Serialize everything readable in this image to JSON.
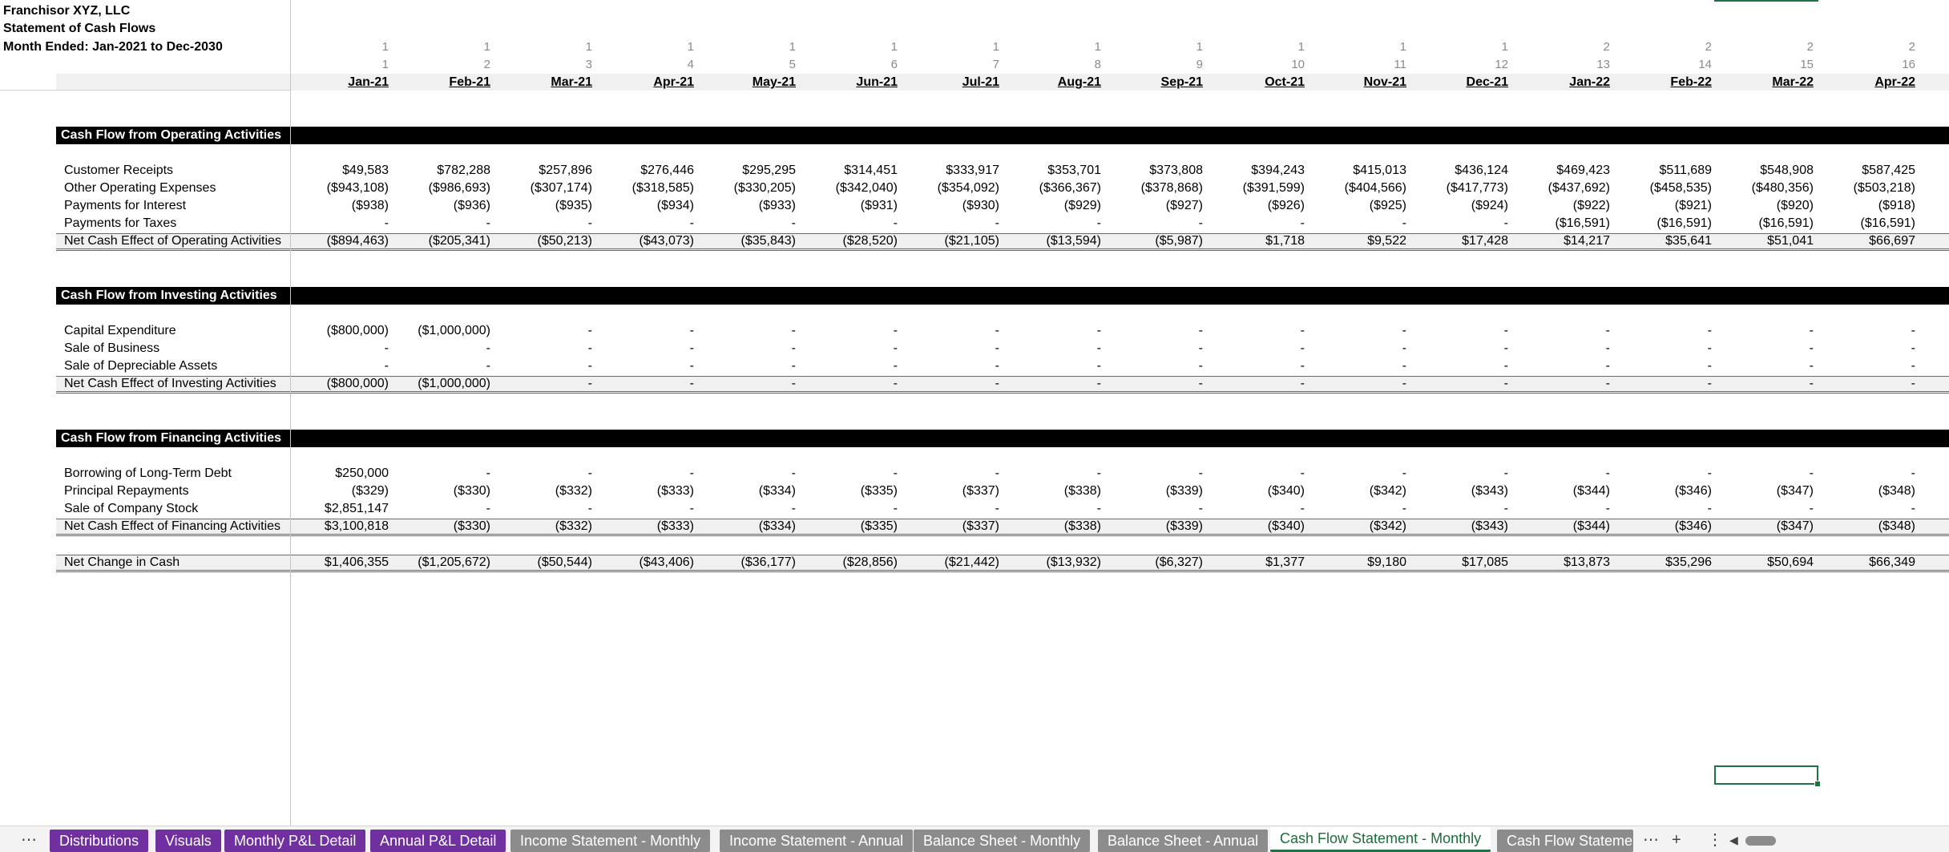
{
  "header": {
    "company": "Franchisor XYZ, LLC",
    "statement": "Statement of Cash Flows",
    "period": "Month Ended: Jan-2021 to Dec-2030"
  },
  "columns": {
    "year_index": [
      "1",
      "1",
      "1",
      "1",
      "1",
      "1",
      "1",
      "1",
      "1",
      "1",
      "1",
      "1",
      "2",
      "2",
      "2",
      "2"
    ],
    "month_index": [
      "1",
      "2",
      "3",
      "4",
      "5",
      "6",
      "7",
      "8",
      "9",
      "10",
      "11",
      "12",
      "13",
      "14",
      "15",
      "16"
    ],
    "months": [
      "Jan-21",
      "Feb-21",
      "Mar-21",
      "Apr-21",
      "May-21",
      "Jun-21",
      "Jul-21",
      "Aug-21",
      "Sep-21",
      "Oct-21",
      "Nov-21",
      "Dec-21",
      "Jan-22",
      "Feb-22",
      "Mar-22",
      "Apr-22"
    ]
  },
  "sections": [
    {
      "title": "Cash Flow from Operating Activities",
      "rows": [
        {
          "label": "Customer Receipts",
          "values": [
            "$49,583",
            "$782,288",
            "$257,896",
            "$276,446",
            "$295,295",
            "$314,451",
            "$333,917",
            "$353,701",
            "$373,808",
            "$394,243",
            "$415,013",
            "$436,124",
            "$469,423",
            "$511,689",
            "$548,908",
            "$587,425"
          ]
        },
        {
          "label": "Other Operating Expenses",
          "values": [
            "($943,108)",
            "($986,693)",
            "($307,174)",
            "($318,585)",
            "($330,205)",
            "($342,040)",
            "($354,092)",
            "($366,367)",
            "($378,868)",
            "($391,599)",
            "($404,566)",
            "($417,773)",
            "($437,692)",
            "($458,535)",
            "($480,356)",
            "($503,218)"
          ]
        },
        {
          "label": "Payments for Interest",
          "values": [
            "($938)",
            "($936)",
            "($935)",
            "($934)",
            "($933)",
            "($931)",
            "($930)",
            "($929)",
            "($927)",
            "($926)",
            "($925)",
            "($924)",
            "($922)",
            "($921)",
            "($920)",
            "($918)"
          ]
        },
        {
          "label": "Payments for Taxes",
          "values": [
            "-",
            "-",
            "-",
            "-",
            "-",
            "-",
            "-",
            "-",
            "-",
            "-",
            "-",
            "-",
            "($16,591)",
            "($16,591)",
            "($16,591)",
            "($16,591)"
          ]
        }
      ],
      "total": {
        "label": "Net Cash Effect of Operating Activities",
        "values": [
          "($894,463)",
          "($205,341)",
          "($50,213)",
          "($43,073)",
          "($35,843)",
          "($28,520)",
          "($21,105)",
          "($13,594)",
          "($5,987)",
          "$1,718",
          "$9,522",
          "$17,428",
          "$14,217",
          "$35,641",
          "$51,041",
          "$66,697"
        ]
      }
    },
    {
      "title": "Cash Flow from Investing Activities",
      "rows": [
        {
          "label": "Capital Expenditure",
          "values": [
            "($800,000)",
            "($1,000,000)",
            "-",
            "-",
            "-",
            "-",
            "-",
            "-",
            "-",
            "-",
            "-",
            "-",
            "-",
            "-",
            "-",
            "-"
          ]
        },
        {
          "label": "Sale of Business",
          "values": [
            "-",
            "-",
            "-",
            "-",
            "-",
            "-",
            "-",
            "-",
            "-",
            "-",
            "-",
            "-",
            "-",
            "-",
            "-",
            "-"
          ]
        },
        {
          "label": "Sale of Depreciable Assets",
          "values": [
            "-",
            "-",
            "-",
            "-",
            "-",
            "-",
            "-",
            "-",
            "-",
            "-",
            "-",
            "-",
            "-",
            "-",
            "-",
            "-"
          ]
        }
      ],
      "total": {
        "label": "Net Cash Effect of Investing Activities",
        "values": [
          "($800,000)",
          "($1,000,000)",
          "-",
          "-",
          "-",
          "-",
          "-",
          "-",
          "-",
          "-",
          "-",
          "-",
          "-",
          "-",
          "-",
          "-"
        ]
      }
    },
    {
      "title": "Cash Flow from Financing Activities",
      "rows": [
        {
          "label": "Borrowing of Long-Term Debt",
          "values": [
            "$250,000",
            "-",
            "-",
            "-",
            "-",
            "-",
            "-",
            "-",
            "-",
            "-",
            "-",
            "-",
            "-",
            "-",
            "-",
            "-"
          ]
        },
        {
          "label": "Principal Repayments",
          "values": [
            "($329)",
            "($330)",
            "($332)",
            "($333)",
            "($334)",
            "($335)",
            "($337)",
            "($338)",
            "($339)",
            "($340)",
            "($342)",
            "($343)",
            "($344)",
            "($346)",
            "($347)",
            "($348)"
          ]
        },
        {
          "label": "Sale of Company Stock",
          "values": [
            "$2,851,147",
            "-",
            "-",
            "-",
            "-",
            "-",
            "-",
            "-",
            "-",
            "-",
            "-",
            "-",
            "-",
            "-",
            "-",
            "-"
          ]
        }
      ],
      "total": {
        "label": "Net Cash Effect of Financing Activities",
        "values": [
          "$3,100,818",
          "($330)",
          "($332)",
          "($333)",
          "($334)",
          "($335)",
          "($337)",
          "($338)",
          "($339)",
          "($340)",
          "($342)",
          "($343)",
          "($344)",
          "($346)",
          "($347)",
          "($348)"
        ]
      }
    }
  ],
  "net_change": {
    "label": "Net Change in Cash",
    "values": [
      "$1,406,355",
      "($1,205,672)",
      "($50,544)",
      "($43,406)",
      "($36,177)",
      "($28,856)",
      "($21,442)",
      "($13,932)",
      "($6,327)",
      "$1,377",
      "$9,180",
      "$17,085",
      "$13,873",
      "$35,296",
      "$50,694",
      "$66,349"
    ]
  },
  "tabs": {
    "more_left": "⋯",
    "items": [
      {
        "label": "Distributions",
        "style": "purple"
      },
      {
        "label": "Visuals",
        "style": "purple"
      },
      {
        "label": "Monthly P&L Detail",
        "style": "purple"
      },
      {
        "label": "Annual P&L Detail",
        "style": "purple"
      },
      {
        "label": "Income Statement - Monthly",
        "style": "gray"
      },
      {
        "label": "Income Statement - Annual",
        "style": "gray"
      },
      {
        "label": "Balance Sheet - Monthly",
        "style": "gray"
      },
      {
        "label": "Balance Sheet - Annual",
        "style": "gray"
      },
      {
        "label": "Cash Flow Statement - Monthly",
        "style": "active"
      },
      {
        "label": "Cash Flow Statemen",
        "style": "gray"
      }
    ],
    "more_right": "⋯",
    "add": "+",
    "options": "⋮",
    "scroll_left": "◀"
  },
  "colors": {
    "accent": "#217346",
    "purple_tab": "#7030a0",
    "gray_tab": "#8c8c8c",
    "section_bar": "#000000"
  }
}
